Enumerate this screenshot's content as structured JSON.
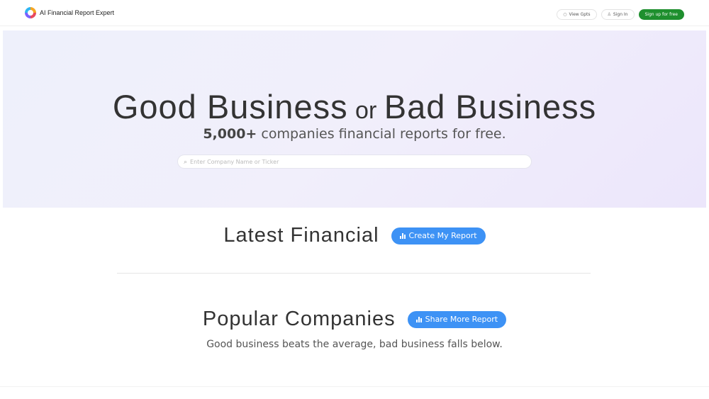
{
  "header": {
    "brand": "AI Financial Report Expert",
    "nav": [
      {
        "label": "View Gpts",
        "icon": "chat-icon"
      },
      {
        "label": "Sign In",
        "icon": "user-icon"
      },
      {
        "label": "Sign up for free"
      }
    ]
  },
  "hero": {
    "title_left": "Good Business",
    "title_or": "or",
    "title_right": "Bad Business",
    "subtitle_strong": "5,000+",
    "subtitle_rest": " companies financial reports for free.",
    "search_placeholder": "Enter Company Name or Ticker",
    "search_value": ""
  },
  "latest": {
    "title": "Latest Financial",
    "button": "Create My Report"
  },
  "popular": {
    "title": "Popular Companies",
    "button": "Share More Report",
    "caption": "Good business beats the average, bad business falls below."
  },
  "colors": {
    "primary_green": "#1e8f2e",
    "accent_blue": "#3d92f5"
  }
}
